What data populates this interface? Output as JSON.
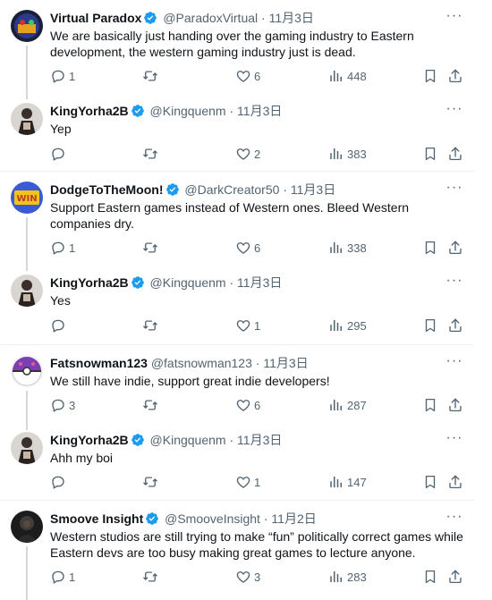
{
  "tweets": [
    {
      "name": "Virtual Paradox",
      "handle": "@ParadoxVirtual",
      "dot": "·",
      "date": "11月3日",
      "text": "We are basically just handing over the gaming industry to Eastern development, the western gaming industry just is dead.",
      "replies": "1",
      "retweets": "",
      "likes": "6",
      "views": "448"
    },
    {
      "name": "KingYorha2B",
      "handle": "@Kingquenm",
      "dot": "·",
      "date": "11月3日",
      "text": "Yep",
      "replies": "",
      "retweets": "",
      "likes": "2",
      "views": "383"
    },
    {
      "name": "DodgeToTheMoon!",
      "handle": "@DarkCreator50",
      "dot": "·",
      "date": "11月3日",
      "text": "Support Eastern games instead of Western ones. Bleed Western companies dry.",
      "replies": "1",
      "retweets": "",
      "likes": "6",
      "views": "338"
    },
    {
      "name": "KingYorha2B",
      "handle": "@Kingquenm",
      "dot": "·",
      "date": "11月3日",
      "text": "Yes",
      "replies": "",
      "retweets": "",
      "likes": "1",
      "views": "295"
    },
    {
      "name": "Fatsnowman123",
      "handle": "@fatsnowman123",
      "dot": "·",
      "date": "11月3日",
      "text": "We still have indie, support great indie developers!",
      "replies": "3",
      "retweets": "",
      "likes": "6",
      "views": "287"
    },
    {
      "name": "KingYorha2B",
      "handle": "@Kingquenm",
      "dot": "·",
      "date": "11月3日",
      "text": "Ahh my boi",
      "replies": "",
      "retweets": "",
      "likes": "1",
      "views": "147"
    },
    {
      "name": "Smoove Insight",
      "handle": "@SmooveInsight",
      "dot": "·",
      "date": "11月2日",
      "text": "Western studios are still trying to make “fun” politically correct games while Eastern devs are too busy making great games to lecture anyone.",
      "replies": "1",
      "retweets": "",
      "likes": "3",
      "views": "283"
    }
  ],
  "icons": {
    "more": "more-icon",
    "verified": "verified-badge-icon",
    "reply": "reply-icon",
    "retweet": "retweet-icon",
    "like": "like-icon",
    "views": "views-icon",
    "bookmark": "bookmark-icon",
    "share": "share-icon"
  },
  "colors": {
    "text": "#0f1419",
    "secondary": "#536471",
    "verified": "#1d9bf0",
    "separator": "#eff3f4",
    "thread_line": "#cfd9de"
  }
}
